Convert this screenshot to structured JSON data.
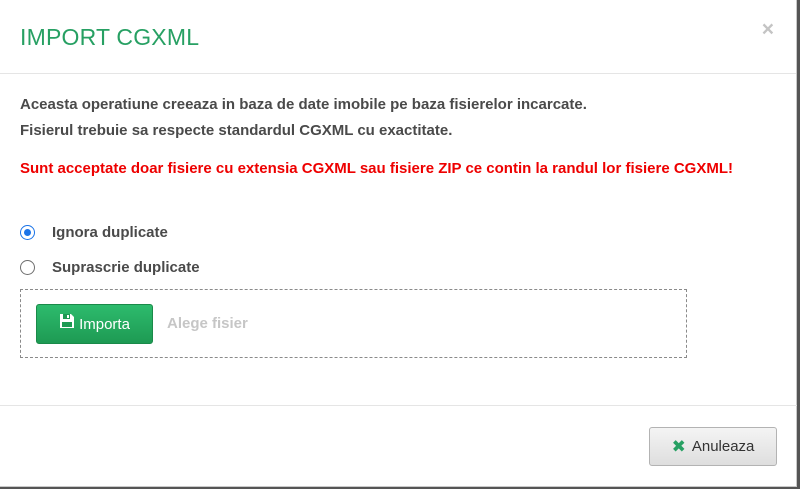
{
  "dialog": {
    "title": "IMPORT CGXML",
    "close_glyph": "×"
  },
  "body": {
    "info_line_1": "Aceasta operatiune creeaza in baza de date imobile pe baza fisierelor incarcate.",
    "info_line_2": "Fisierul trebuie sa respecte standardul CGXML cu exactitate.",
    "warning": "Sunt acceptate doar fisiere cu extensia CGXML sau fisiere ZIP ce contin la randul lor fisiere CGXML!",
    "options": [
      {
        "label": "Ignora duplicate",
        "selected": true
      },
      {
        "label": "Suprascrie duplicate",
        "selected": false
      }
    ]
  },
  "upload": {
    "button_label": "Importa",
    "button_icon": "floppy-disk-icon",
    "placeholder": "Alege fisier"
  },
  "footer": {
    "cancel_label": "Anuleaza",
    "cancel_icon": "x-icon"
  },
  "colors": {
    "title": "#27a063",
    "warning": "#ee0000",
    "import_button": "#22aa5e",
    "radio_accent": "#1a73e8"
  }
}
